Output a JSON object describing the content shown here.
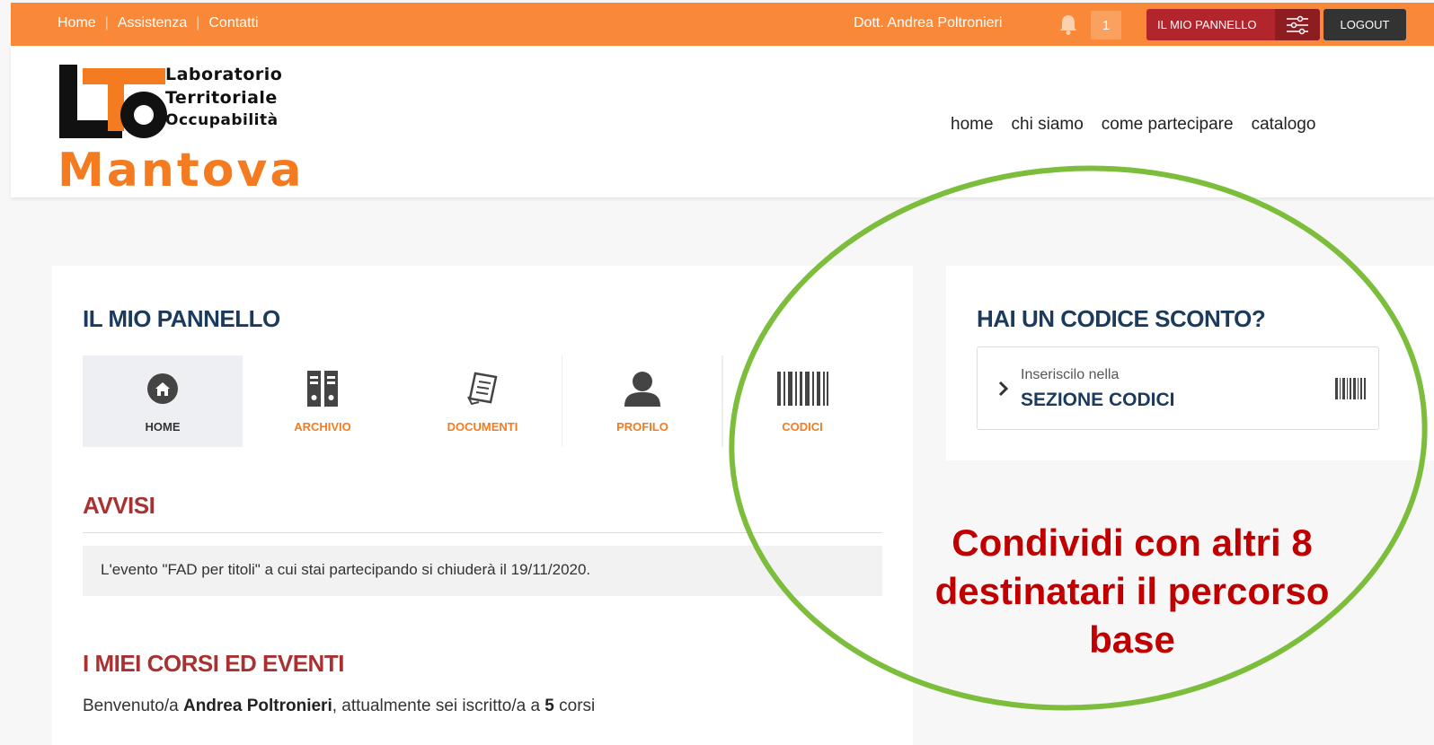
{
  "topbar": {
    "links": [
      "Home",
      "Assistenza",
      "Contatti"
    ],
    "user_name": "Dott. Andrea Poltronieri",
    "notification_count": "1",
    "panel_button": "IL MIO PANNELLO",
    "logout_button": "LOGOUT"
  },
  "logo": {
    "lines": [
      "Laboratorio",
      "Territoriale",
      "Occupabilità"
    ],
    "city": "Mantova"
  },
  "nav": {
    "items": [
      "home",
      "chi siamo",
      "come partecipare",
      "catalogo"
    ]
  },
  "panel": {
    "title": "IL MIO PANNELLO",
    "tiles": [
      {
        "label": "HOME",
        "icon": "home-icon"
      },
      {
        "label": "ARCHIVIO",
        "icon": "archive-binders-icon"
      },
      {
        "label": "DOCUMENTI",
        "icon": "document-icon"
      },
      {
        "label": "PROFILO",
        "icon": "user-icon"
      },
      {
        "label": "CODICI",
        "icon": "barcode-icon"
      }
    ]
  },
  "avvisi": {
    "title": "AVVISI",
    "notice": "L'evento \"FAD per titoli\" a cui stai partecipando si chiuderà il 19/11/2020."
  },
  "corsi": {
    "title": "I MIEI CORSI ED EVENTI",
    "welcome_prefix": "Benvenuto/a ",
    "welcome_name": "Andrea Poltronieri",
    "welcome_middle": ", attualmente sei iscritto/a a ",
    "welcome_count": "5",
    "welcome_suffix": " corsi"
  },
  "sconto": {
    "title": "HAI UN CODICE SCONTO?",
    "small": "Inseriscilo nella",
    "big": "SEZIONE CODICI"
  },
  "annotation": {
    "text": "Condividi con altri 8 destinatari il percorso base"
  },
  "colors": {
    "topbar": "#f98838",
    "panel_button": "#b3252c",
    "accent_orange": "#f47b20",
    "title_navy": "#1b3a5c",
    "section_red": "#a83232",
    "annotation_red": "#c00000",
    "ellipse_green": "#7cbd3c"
  }
}
